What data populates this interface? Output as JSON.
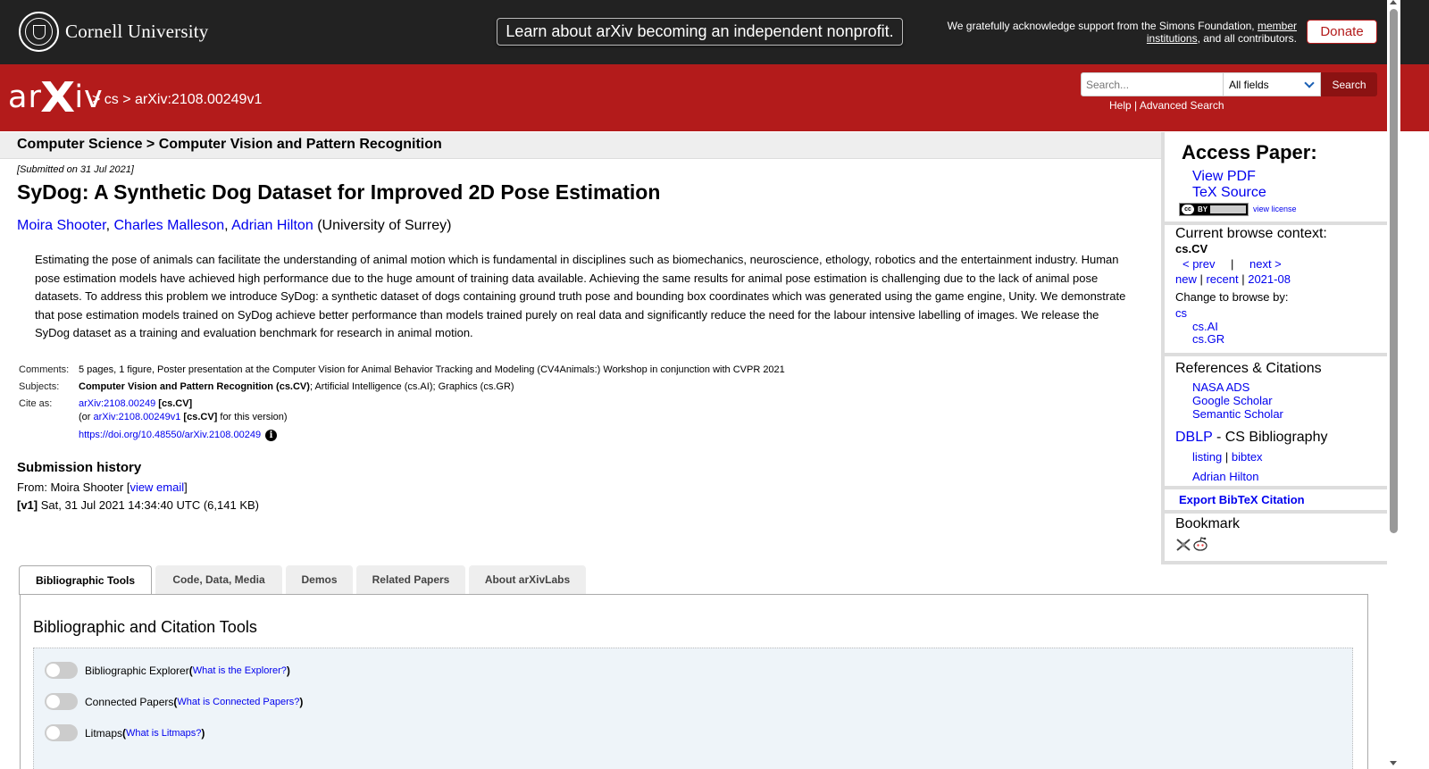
{
  "banner": {
    "cornell_name": "Cornell University",
    "learn_button": "Learn about arXiv becoming an independent nonprofit.",
    "support_prefix": "We gratefully acknowledge support from the Simons Foundation,",
    "support_link": "member institutions",
    "support_suffix": ", and all contributors.",
    "donate": "Donate"
  },
  "header": {
    "logo_left": "ar",
    "logo_x": "X",
    "logo_right": "iv",
    "breadcrumb": "> cs > arXiv:2108.00249v1",
    "search_placeholder": "Search...",
    "search_field": "All fields",
    "search_button": "Search",
    "help": "Help",
    "sep": " | ",
    "advanced_search": "Advanced Search"
  },
  "paper": {
    "subject_path": "Computer Science > Computer Vision and Pattern Recognition",
    "submitted": "[Submitted on 31 Jul 2021]",
    "title": "SyDog: A Synthetic Dog Dataset for Improved 2D Pose Estimation",
    "authors": [
      "Moira Shooter",
      "Charles Malleson",
      "Adrian Hilton"
    ],
    "affiliation": "(University of Surrey)",
    "abstract": "Estimating the pose of animals can facilitate the understanding of animal motion which is fundamental in disciplines such as biomechanics, neuroscience, ethology, robotics and the entertainment industry. Human pose estimation models have achieved high performance due to the huge amount of training data available. Achieving the same results for animal pose estimation is challenging due to the lack of animal pose datasets. To address this problem we introduce SyDog: a synthetic dataset of dogs containing ground truth pose and bounding box coordinates which was generated using the game engine, Unity. We demonstrate that pose estimation models trained on SyDog achieve better performance than models trained purely on real data and significantly reduce the need for the labour intensive labelling of images. We release the SyDog dataset as a training and evaluation benchmark for research in animal motion.",
    "comments_label": "Comments:",
    "comments": "5 pages, 1 figure, Poster presentation at the Computer Vision for Animal Behavior Tracking and Modeling (CV4Animals:) Workshop in conjunction with CVPR 2021",
    "subjects_label": "Subjects:",
    "subjects_primary": "Computer Vision and Pattern Recognition (cs.CV)",
    "subjects_rest": "; Artificial Intelligence (cs.AI); Graphics (cs.GR)",
    "cite_label": "Cite as:",
    "cite_id": "arXiv:2108.00249",
    "cite_tag": "[cs.CV]",
    "cite_or": "(or ",
    "cite_version": "arXiv:2108.00249v1",
    "cite_version_suffix": " for this version)",
    "doi": "https://doi.org/10.48550/arXiv.2108.00249",
    "info_glyph": "i",
    "history_title": "Submission history",
    "from_prefix": "From: Moira Shooter [",
    "view_email": "view email",
    "from_suffix": "]",
    "v1_label": "[v1]",
    "v1_text": " Sat, 31 Jul 2021 14:34:40 UTC (6,141 KB)"
  },
  "sidebar": {
    "access_title": "Access Paper:",
    "view_pdf": "View PDF",
    "tex_source": "TeX Source",
    "cc_text": "cc",
    "by_text": "BY",
    "view_license": "view license",
    "browse_title": "Current browse context:",
    "browse_context": "cs.CV",
    "prev": "< prev",
    "pipe": "|",
    "next": "next >",
    "new": "new",
    "recent": "recent",
    "month": "2021-08",
    "change_browse": "Change to browse by:",
    "cs": "cs",
    "cs_ai": "cs.AI",
    "cs_gr": "cs.GR",
    "refs_title": "References & Citations",
    "nasa": "NASA ADS",
    "scholar": "Google Scholar",
    "semantic": "Semantic Scholar",
    "dblp": "DBLP",
    "dblp_suffix": " - CS Bibliography",
    "listing": "listing",
    "bibtex": "bibtex",
    "dblp_author": "Adrian Hilton",
    "export_bibtex": "Export BibTeX Citation",
    "bookmark_title": "Bookmark"
  },
  "tabs": [
    "Bibliographic Tools",
    "Code, Data, Media",
    "Demos",
    "Related Papers",
    "About arXivLabs"
  ],
  "tools": {
    "title": "Bibliographic and Citation Tools",
    "items": [
      {
        "label": "Bibliographic Explorer",
        "open": " (",
        "link": "What is the Explorer?",
        "close": ")"
      },
      {
        "label": "Connected Papers",
        "open": " (",
        "link": "What is Connected Papers?",
        "close": ")"
      },
      {
        "label": "Litmaps",
        "open": " (",
        "link": "What is Litmaps?",
        "close": ")"
      }
    ]
  },
  "colors": {
    "arxiv_red": "#b31b1b",
    "banner_dark": "#222222",
    "link_blue": "#0000ee"
  }
}
